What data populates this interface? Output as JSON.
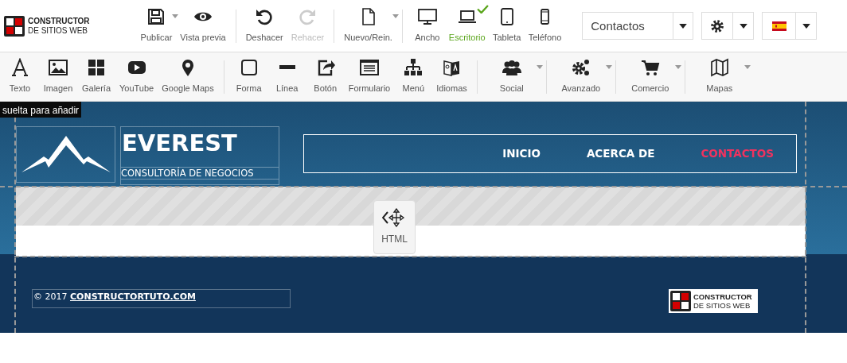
{
  "app_logo": {
    "line1": "CONSTRUCTOR",
    "line2": "DE SITIOS WEB"
  },
  "main_toolbar": [
    {
      "items": [
        {
          "label": "Publicar",
          "kind": "save",
          "caret": true,
          "disabled": false
        },
        {
          "label": "Vista previa",
          "kind": "preview",
          "caret": false,
          "disabled": false
        }
      ]
    },
    {
      "items": [
        {
          "label": "Deshacer",
          "kind": "undo",
          "caret": false,
          "disabled": false
        },
        {
          "label": "Rehacer",
          "kind": "redo",
          "caret": false,
          "disabled": true
        }
      ]
    },
    {
      "items": [
        {
          "label": "Nuevo/Rein.",
          "kind": "new",
          "caret": true,
          "disabled": false
        }
      ]
    }
  ],
  "devices": [
    {
      "label": "Ancho",
      "kind": "monitor",
      "selected": false
    },
    {
      "label": "Escritorio",
      "kind": "laptop",
      "selected": true
    },
    {
      "label": "Tableta",
      "kind": "tablet",
      "selected": false
    },
    {
      "label": "Teléfono",
      "kind": "phone",
      "selected": false
    }
  ],
  "page_select": {
    "value": "Contactos"
  },
  "insert_toolbar": [
    {
      "items": [
        {
          "label": "Texto",
          "kind": "text",
          "caret": false
        },
        {
          "label": "Imagen",
          "kind": "image",
          "caret": false
        },
        {
          "label": "Galería",
          "kind": "gallery",
          "caret": false
        },
        {
          "label": "YouTube",
          "kind": "video",
          "caret": false
        },
        {
          "label": "Google Maps",
          "kind": "pin",
          "caret": false
        }
      ]
    },
    {
      "items": [
        {
          "label": "Forma",
          "kind": "shape",
          "caret": false
        },
        {
          "label": "Línea",
          "kind": "line",
          "caret": false
        },
        {
          "label": "Botón",
          "kind": "share",
          "caret": false
        },
        {
          "label": "Formulario",
          "kind": "form",
          "caret": false
        },
        {
          "label": "Menú",
          "kind": "sitemap",
          "caret": false
        },
        {
          "label": "Idiomas",
          "kind": "languages",
          "caret": false
        }
      ]
    },
    {
      "items": [
        {
          "label": "Social",
          "kind": "people",
          "caret": true
        }
      ]
    },
    {
      "items": [
        {
          "label": "Avanzado",
          "kind": "gears",
          "caret": true
        }
      ]
    },
    {
      "items": [
        {
          "label": "Comercio",
          "kind": "cart",
          "caret": true
        }
      ]
    },
    {
      "items": [
        {
          "label": "Mapas",
          "kind": "map",
          "caret": true
        }
      ]
    }
  ],
  "tooltip": "suelta para añadir",
  "site": {
    "title": "EVEREST",
    "subtitle": "CONSULTORÍA DE NEGOCIOS",
    "nav": [
      {
        "label": "INICIO",
        "selected": false
      },
      {
        "label": "ACERCA DE",
        "selected": false
      },
      {
        "label": "CONTACTOS",
        "selected": true
      }
    ],
    "html_block": {
      "label": "HTML"
    },
    "footer": {
      "copyright": "© 2017",
      "link": "CONSTRUCTORTUTO.COM",
      "logo": {
        "line1": "CONSTRUCTOR",
        "line2": "DE SITIOS WEB"
      }
    }
  }
}
